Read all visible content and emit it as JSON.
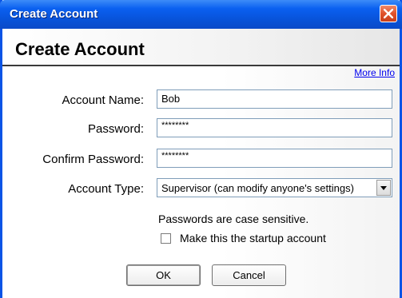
{
  "window": {
    "title": "Create Account",
    "close_icon": "close-icon",
    "accent_color": "#0a54e6"
  },
  "header": {
    "heading": "Create Account",
    "more_info_link": "More Info"
  },
  "form": {
    "account_name": {
      "label": "Account Name:",
      "value": "Bob"
    },
    "password": {
      "label": "Password:",
      "value": "********"
    },
    "confirm_password": {
      "label": "Confirm Password:",
      "value": "********"
    },
    "account_type": {
      "label": "Account Type:",
      "selected": "Supervisor (can modify anyone's settings)",
      "arrow_icon": "chevron-down-icon"
    },
    "note": "Passwords are case sensitive.",
    "startup_checkbox": {
      "label": "Make this the startup account",
      "checked": false
    }
  },
  "buttons": {
    "ok": "OK",
    "cancel": "Cancel"
  }
}
